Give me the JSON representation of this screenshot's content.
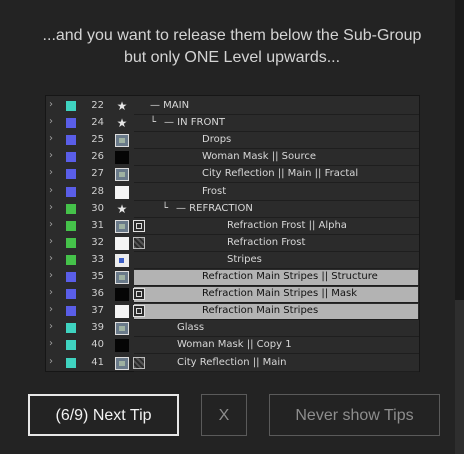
{
  "header": {
    "line1": "...and you want to release them below the Sub-Group",
    "line2": "but only ONE Level upwards..."
  },
  "layers": [
    {
      "num": "22",
      "color": "#3fd3c0",
      "icon": "star-icon",
      "name": "— MAIN",
      "indent": 104,
      "prefix": ""
    },
    {
      "num": "24",
      "color": "#5a5ee8",
      "icon": "star-icon",
      "name": "— IN FRONT",
      "indent": 118,
      "prefix": "└"
    },
    {
      "num": "25",
      "color": "#5a5ee8",
      "icon": "image-icon",
      "name": "Drops",
      "indent": 156,
      "prefix": ""
    },
    {
      "num": "26",
      "color": "#5a5ee8",
      "icon": "black-solid-icon",
      "name": "Woman Mask || Source",
      "indent": 156,
      "prefix": ""
    },
    {
      "num": "27",
      "color": "#5a5ee8",
      "icon": "image-icon",
      "name": "City Reflection || Main || Fractal",
      "indent": 156,
      "prefix": ""
    },
    {
      "num": "28",
      "color": "#5a5ee8",
      "icon": "white-solid-icon",
      "name": "Frost",
      "indent": 156,
      "prefix": ""
    },
    {
      "num": "30",
      "color": "#45c24a",
      "icon": "star-icon",
      "name": "— REFRACTION",
      "indent": 130,
      "prefix": "└"
    },
    {
      "num": "31",
      "color": "#45c24a",
      "icon": "image-icon",
      "icon2": "matte-icon",
      "name": "Refraction Frost || Alpha",
      "indent": 181,
      "prefix": ""
    },
    {
      "num": "32",
      "color": "#45c24a",
      "icon": "white-solid-icon",
      "icon2": "track-matte-icon",
      "name": "Refraction Frost",
      "indent": 181,
      "prefix": ""
    },
    {
      "num": "33",
      "color": "#45c24a",
      "icon": "blue-comp-icon",
      "name": "Stripes",
      "indent": 181,
      "prefix": ""
    },
    {
      "num": "35",
      "color": "#5a5ee8",
      "icon": "image-icon",
      "name": "Refraction Main Stripes || Structure",
      "indent": 156,
      "prefix": "",
      "highlight": true
    },
    {
      "num": "36",
      "color": "#5a5ee8",
      "icon": "black-solid-icon",
      "icon2": "matte-icon",
      "name": "Refraction Main Stripes || Mask",
      "indent": 156,
      "prefix": "",
      "highlight": true
    },
    {
      "num": "37",
      "color": "#5a5ee8",
      "icon": "white-solid-icon",
      "icon2": "matte-icon",
      "name": "Refraction Main Stripes",
      "indent": 156,
      "prefix": "",
      "highlight": true
    },
    {
      "num": "39",
      "color": "#3fd3c0",
      "icon": "image-icon",
      "name": "Glass",
      "indent": 131,
      "prefix": ""
    },
    {
      "num": "40",
      "color": "#3fd3c0",
      "icon": "black-solid-icon",
      "name": "Woman Mask || Copy 1",
      "indent": 131,
      "prefix": ""
    },
    {
      "num": "41",
      "color": "#3fd3c0",
      "icon": "image-icon",
      "icon2": "track-matte-icon",
      "name": "City Reflection || Main",
      "indent": 131,
      "prefix": ""
    }
  ],
  "buttons": {
    "next": "(6/9) Next Tip",
    "close": "X",
    "never": "Never show Tips"
  },
  "colors": {
    "background": "#232323",
    "highlight_row": "#b3b3b3",
    "primary_border": "#e8e8e8"
  }
}
